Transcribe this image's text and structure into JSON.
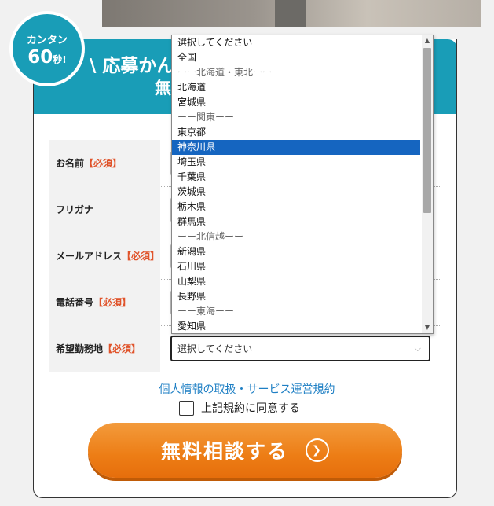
{
  "badge": {
    "line1": "カンタン",
    "num": "60",
    "unit": "秒!"
  },
  "header": {
    "title": "\\ 応募かん",
    "title2": "無"
  },
  "form": {
    "fields": [
      {
        "label": "お名前",
        "required": "【必須】"
      },
      {
        "label": "フリガナ",
        "required": ""
      },
      {
        "label": "メールアドレス",
        "required": "【必須】"
      },
      {
        "label": "電話番号",
        "required": "【必須】"
      },
      {
        "label": "希望勤務地",
        "required": "【必須】"
      }
    ],
    "location_select": {
      "value": "選択してください"
    }
  },
  "dropdown": {
    "options": [
      {
        "label": "選択してください",
        "type": "option"
      },
      {
        "label": "全国",
        "type": "option"
      },
      {
        "label": "ーー北海道・東北ーー",
        "type": "group"
      },
      {
        "label": "北海道",
        "type": "option"
      },
      {
        "label": "宮城県",
        "type": "option"
      },
      {
        "label": "ーー関東ーー",
        "type": "group"
      },
      {
        "label": "東京都",
        "type": "option"
      },
      {
        "label": "神奈川県",
        "type": "selected"
      },
      {
        "label": "埼玉県",
        "type": "option"
      },
      {
        "label": "千葉県",
        "type": "option"
      },
      {
        "label": "茨城県",
        "type": "option"
      },
      {
        "label": "栃木県",
        "type": "option"
      },
      {
        "label": "群馬県",
        "type": "option"
      },
      {
        "label": "ーー北信越ーー",
        "type": "group"
      },
      {
        "label": "新潟県",
        "type": "option"
      },
      {
        "label": "石川県",
        "type": "option"
      },
      {
        "label": "山梨県",
        "type": "option"
      },
      {
        "label": "長野県",
        "type": "option"
      },
      {
        "label": "ーー東海ーー",
        "type": "group"
      },
      {
        "label": "愛知県",
        "type": "option"
      }
    ]
  },
  "privacy_link": "個人情報の取扱・サービス運営規約",
  "agree_label": "上記規約に同意する",
  "cta_label": "無料相談する",
  "colors": {
    "header": "#199db7",
    "cta": "#ed7d15",
    "required": "#e0532a",
    "link": "#1e7fc4",
    "selected": "#1565c0"
  },
  "icons": {
    "cta_arrow": "chevron-right-circle-icon",
    "select_chevron": "chevron-down-icon"
  }
}
